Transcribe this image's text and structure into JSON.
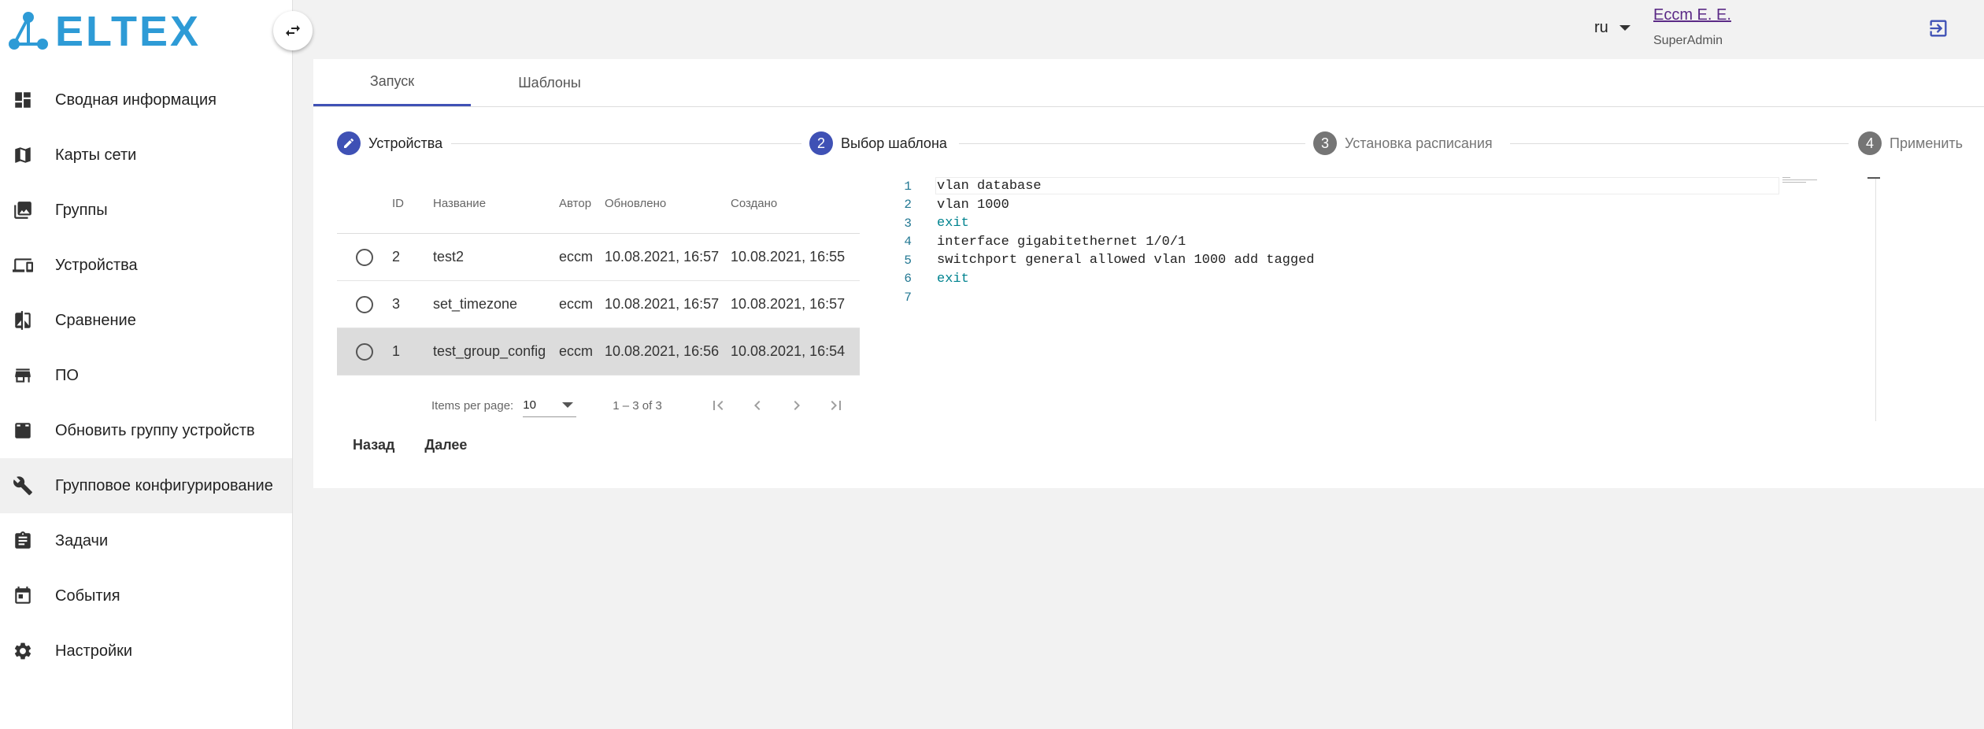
{
  "brand": {
    "logo_text": "ELTEX"
  },
  "sidebar": {
    "items": [
      {
        "label": "Сводная информация",
        "icon": "dashboard-icon"
      },
      {
        "label": "Карты сети",
        "icon": "map-icon"
      },
      {
        "label": "Группы",
        "icon": "photo-library-icon"
      },
      {
        "label": "Устройства",
        "icon": "devices-icon"
      },
      {
        "label": "Сравнение",
        "icon": "compare-icon"
      },
      {
        "label": "ПО",
        "icon": "store-icon"
      },
      {
        "label": "Обновить группу устройств",
        "icon": "download-box-icon"
      },
      {
        "label": "Групповое конфигурирование",
        "icon": "wrench-icon",
        "active": true
      },
      {
        "label": "Задачи",
        "icon": "clipboard-icon"
      },
      {
        "label": "События",
        "icon": "calendar-icon"
      },
      {
        "label": "Настройки",
        "icon": "gear-icon"
      }
    ]
  },
  "header": {
    "lang": "ru",
    "user_name": "Eccm E. E.",
    "user_role": "SuperAdmin"
  },
  "tabs": [
    {
      "label": "Запуск",
      "active": true
    },
    {
      "label": "Шаблоны",
      "active": false
    }
  ],
  "stepper": [
    {
      "num": "",
      "label": "Устройства",
      "state": "done"
    },
    {
      "num": "2",
      "label": "Выбор шаблона",
      "state": "active"
    },
    {
      "num": "3",
      "label": "Установка расписания",
      "state": "pending"
    },
    {
      "num": "4",
      "label": "Применить",
      "state": "pending"
    }
  ],
  "table": {
    "columns": [
      "ID",
      "Название",
      "Автор",
      "Обновлено",
      "Создано"
    ],
    "rows": [
      {
        "id": "2",
        "name": "test2",
        "author": "eccm",
        "updated": "10.08.2021, 16:57",
        "created": "10.08.2021, 16:55",
        "selected": false
      },
      {
        "id": "3",
        "name": "set_timezone",
        "author": "eccm",
        "updated": "10.08.2021, 16:57",
        "created": "10.08.2021, 16:57",
        "selected": false
      },
      {
        "id": "1",
        "name": "test_group_config",
        "author": "eccm",
        "updated": "10.08.2021, 16:56",
        "created": "10.08.2021, 16:54",
        "selected": true
      }
    ]
  },
  "paginator": {
    "items_per_page_label": "Items per page:",
    "page_size": "10",
    "range": "1 – 3 of 3"
  },
  "actions": {
    "back": "Назад",
    "next": "Далее"
  },
  "editor": {
    "lines": [
      {
        "n": "1",
        "text": "vlan database",
        "kw": false
      },
      {
        "n": "2",
        "text": "vlan 1000",
        "kw": false
      },
      {
        "n": "3",
        "text": "exit",
        "kw": true
      },
      {
        "n": "4",
        "text": "interface gigabitethernet 1/0/1",
        "kw": false
      },
      {
        "n": "5",
        "text": "switchport general allowed vlan 1000 add tagged",
        "kw": false
      },
      {
        "n": "6",
        "text": "exit",
        "kw": true
      },
      {
        "n": "7",
        "text": "",
        "kw": false
      }
    ]
  },
  "colors": {
    "primary": "#3f51b5",
    "brand": "#2e9bd6",
    "user_link": "#5b2a86",
    "keyword": "#00838f"
  }
}
